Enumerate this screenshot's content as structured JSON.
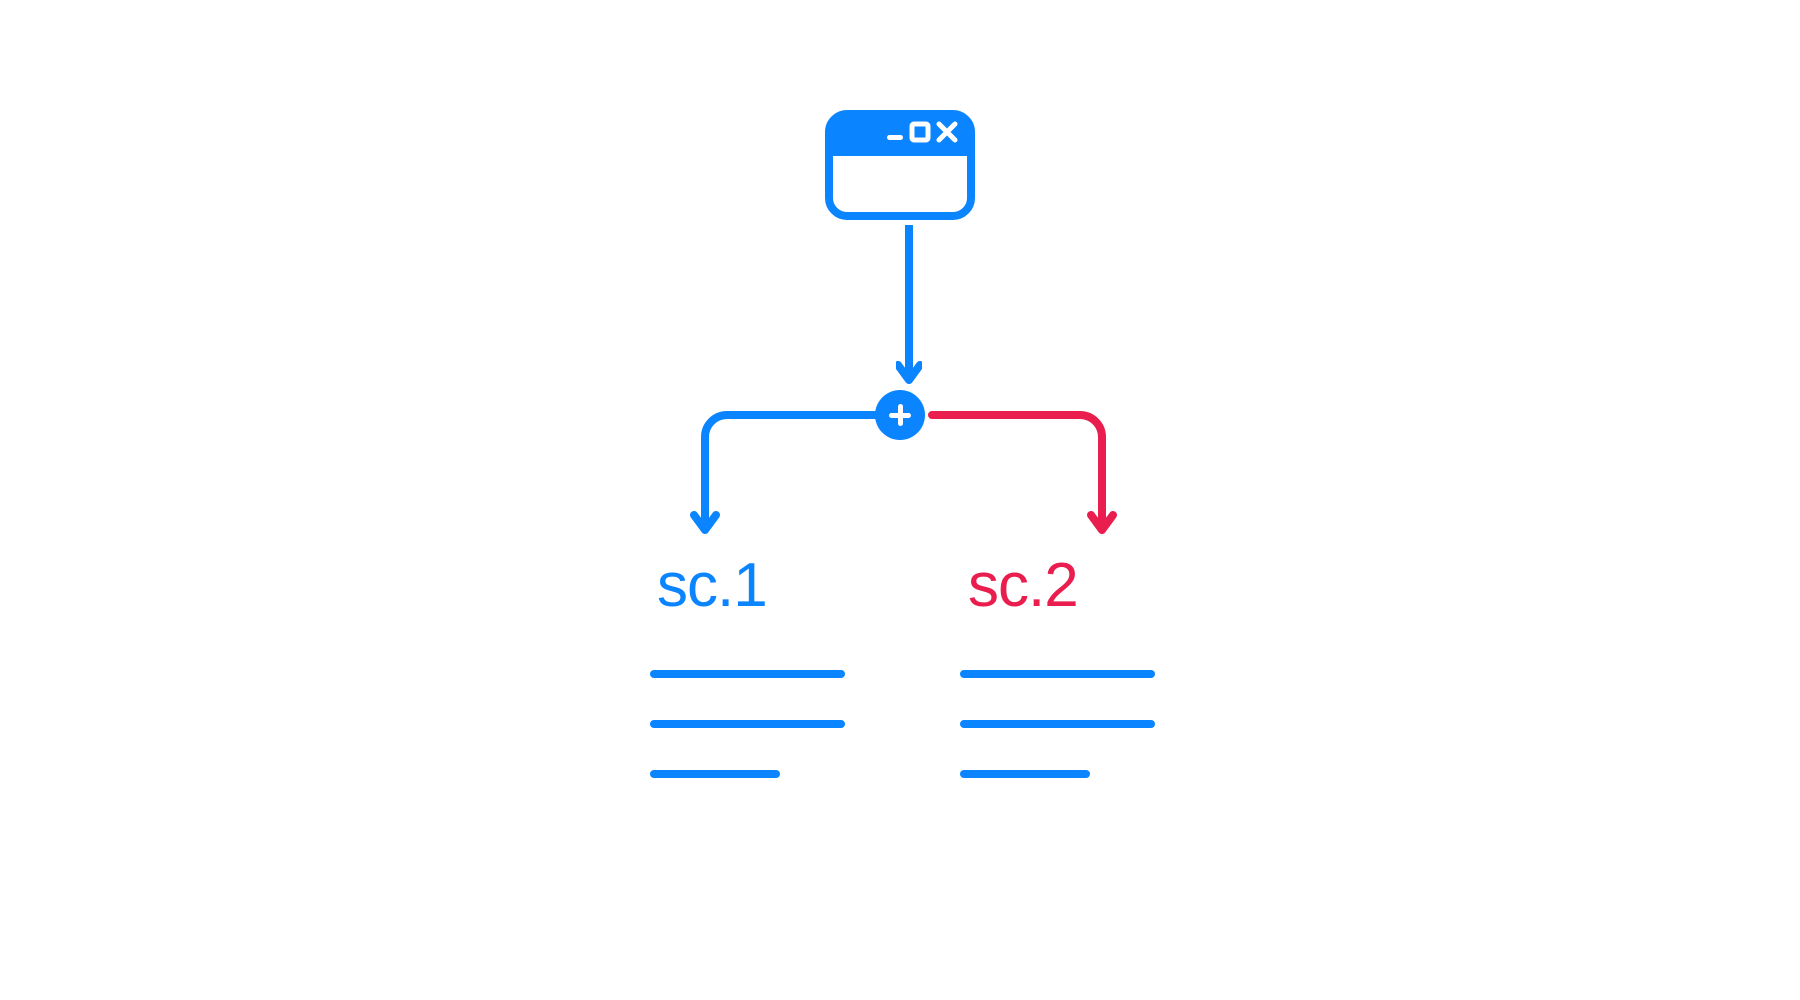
{
  "diagram": {
    "root_node": "window",
    "split_node": "plus",
    "branches": [
      {
        "label": "sc.1",
        "color": "#0A84FF"
      },
      {
        "label": "sc.2",
        "color": "#E91E4E"
      }
    ],
    "colors": {
      "primary": "#0A84FF",
      "secondary": "#E91E4E",
      "background": "#ffffff"
    }
  }
}
